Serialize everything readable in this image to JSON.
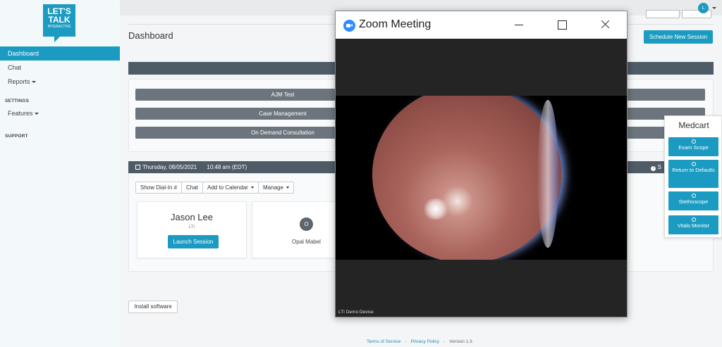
{
  "brand": {
    "logo_line1": "LET'S",
    "logo_line2": "TALK",
    "logo_sub": "INTERACTIVE"
  },
  "sidebar": {
    "items": [
      {
        "label": "Dashboard",
        "active": true
      },
      {
        "label": "Chat"
      },
      {
        "label": "Reports"
      }
    ],
    "settings_heading": "SETTINGS",
    "features_label": "Features",
    "support_heading": "SUPPORT"
  },
  "user": {
    "initial": "L"
  },
  "header": {
    "title": "Dashboard",
    "schedule_button": "Schedule New Session"
  },
  "sessions": [
    "AJM Test",
    "Case Management",
    "On Demand Consultation"
  ],
  "appointment": {
    "date": "Thursday, 08/05/2021",
    "time": "10:48 am (EDT)",
    "status_partial": "S",
    "buttons": {
      "dial_in": "Show Dial-In #",
      "chat": "Chat",
      "add_calendar": "Add to Calendar",
      "manage": "Manage"
    },
    "participants": [
      {
        "name": "Jason Lee",
        "org": "LTI",
        "action": "Launch Session"
      },
      {
        "initial": "O",
        "name": "Opal Mabel"
      }
    ]
  },
  "install_button": "Install software",
  "footer": {
    "terms": "Terms of Service",
    "privacy": "Privacy Policy",
    "version": "Version 1.3",
    "separator": "-"
  },
  "zoom": {
    "title": "Zoom Meeting",
    "caption": "LTI Demo Device"
  },
  "medcart": {
    "title": "Medcart",
    "buttons": [
      "Exam Scope",
      "Return to Defaults",
      "Stethoscope",
      "Vitals Monitor"
    ]
  },
  "colors": {
    "accent": "#1b9bc1",
    "dark_band": "#4f5b66",
    "session_bar": "#6c757d"
  }
}
